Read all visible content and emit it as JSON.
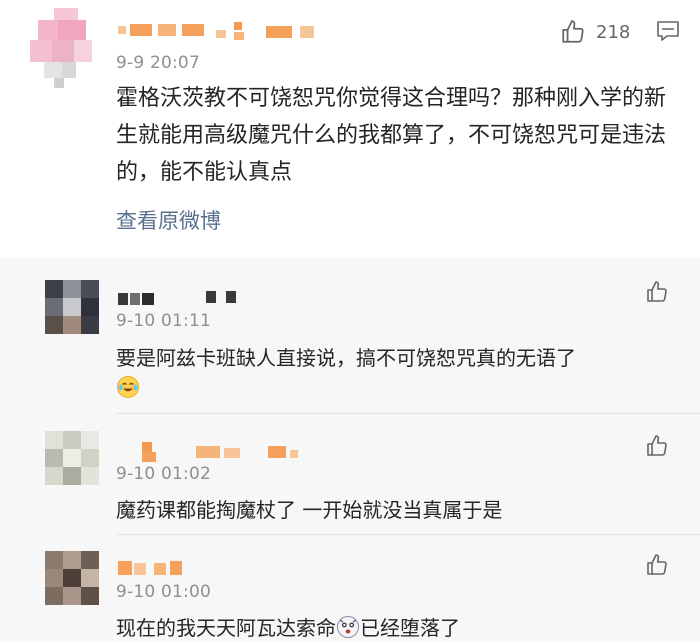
{
  "main_post": {
    "time": "9-9 20:07",
    "text": "霍格沃茨教不可饶恕咒你觉得这合理吗？那种刚入学的新生就能用高级魔咒什么的我都算了，不可饶恕咒可是违法的，能不能认真点",
    "source_link": "查看原微博",
    "like_icon": "thumbs-up-icon",
    "like_count": "218",
    "comment_icon": "comment-icon"
  },
  "replies": [
    {
      "time": "9-10 01:11",
      "text": "要是阿兹卡班缺人直接说，搞不可饶恕咒真的无语了",
      "emoji": "laughing-tears-emoji",
      "like_icon": "thumbs-up-icon"
    },
    {
      "time": "9-10 01:02",
      "text": "魔药课都能掏魔杖了 一开始就没当真属于是",
      "like_icon": "thumbs-up-icon"
    },
    {
      "time": "9-10 01:00",
      "text_before": "现在的我天天阿瓦达索命",
      "emoji": "dizzy-face-emoji",
      "text_after": "已经堕落了",
      "like_icon": "thumbs-up-icon"
    }
  ],
  "colors": {
    "link": "#59708f",
    "meta_gray": "#8f8f8f",
    "reply_background": "#f7f7f7",
    "censor_orange": "#f6a15b",
    "censor_pink": "#f2b5c9"
  }
}
